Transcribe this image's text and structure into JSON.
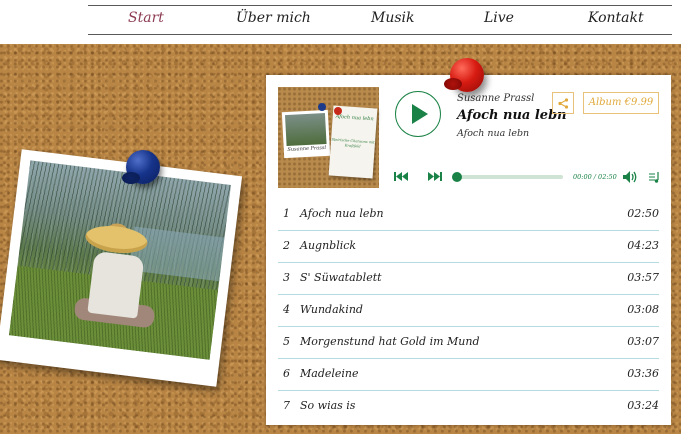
{
  "nav": {
    "items": [
      {
        "label": "Start",
        "active": true
      },
      {
        "label": "Über mich",
        "active": false
      },
      {
        "label": "Musik",
        "active": false
      },
      {
        "label": "Live",
        "active": false
      },
      {
        "label": "Kontakt",
        "active": false
      }
    ]
  },
  "player": {
    "artist": "Susanne Prassl",
    "title": "Afoch nua lebn",
    "album": "Afoch nua lebn",
    "album_button": "Album €9.99",
    "time": "00:00 / 02:50",
    "progress": 0,
    "cover": {
      "photo_caption": "Susanne Prassl",
      "note_title": "Afoch nua lebn",
      "note_subtitle": "Steirische Chansons mit Kraftfeld"
    },
    "tracks": [
      {
        "num": "1",
        "name": "Afoch nua lebn",
        "duration": "02:50"
      },
      {
        "num": "2",
        "name": "Augnblick",
        "duration": "04:23"
      },
      {
        "num": "3",
        "name": "S' Süwatablett",
        "duration": "03:57"
      },
      {
        "num": "4",
        "name": "Wundakind",
        "duration": "03:08"
      },
      {
        "num": "5",
        "name": "Morgenstund hat Gold im Mund",
        "duration": "03:07"
      },
      {
        "num": "6",
        "name": "Madeleine",
        "duration": "03:36"
      },
      {
        "num": "7",
        "name": "So wias is",
        "duration": "03:24"
      }
    ]
  },
  "colors": {
    "accent_green": "#1a8246",
    "accent_gold": "#e0a93a",
    "nav_active": "#8c3b52"
  },
  "icons": {
    "play": "play-icon",
    "share": "share-icon",
    "prev": "skip-back-icon",
    "next": "skip-forward-icon",
    "volume": "volume-icon",
    "playlist": "playlist-icon"
  }
}
